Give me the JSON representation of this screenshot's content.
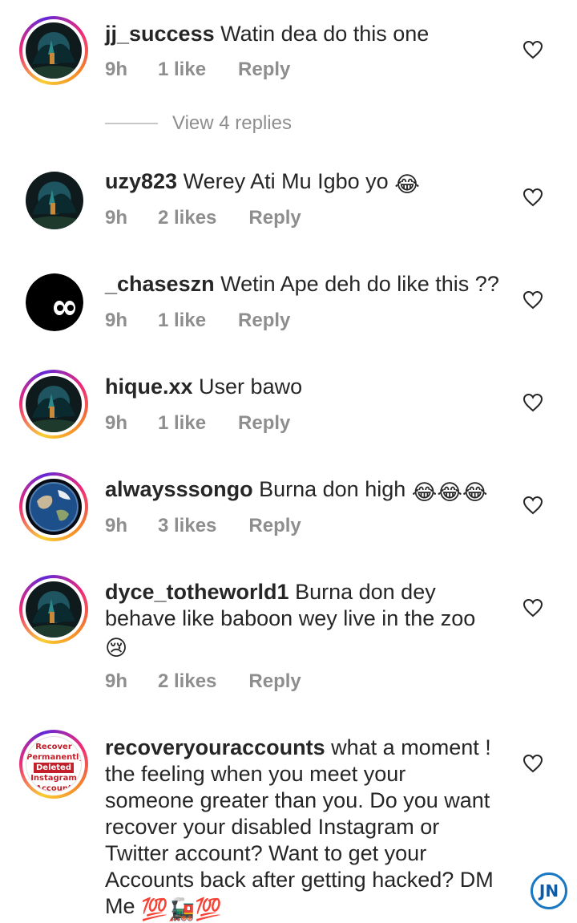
{
  "colors": {
    "text": "#262626",
    "meta": "#8e8e8e",
    "story_ring_start": "#f9ce34",
    "story_ring_mid": "#ee2a7b",
    "story_ring_end": "#6228d7"
  },
  "comments": [
    {
      "username": "jj_success",
      "text": "Watin dea do this one",
      "time": "9h",
      "likes": "1 like",
      "reply": "Reply",
      "avatar": "forest-avatar",
      "has_story": true,
      "view_replies": "View 4 replies"
    },
    {
      "username": "uzy823",
      "text": "Werey Ati Mu Igbo yo",
      "emoji": "😂",
      "time": "9h",
      "likes": "2 likes",
      "reply": "Reply",
      "avatar": "forest-avatar",
      "has_story": false
    },
    {
      "username": "_chaseszn",
      "text": "Wetin Ape deh do like this ??",
      "time": "9h",
      "likes": "1 like",
      "reply": "Reply",
      "avatar": "eyes-avatar",
      "has_story": false
    },
    {
      "username": "hique.xx",
      "text": "User bawo",
      "time": "9h",
      "likes": "1 like",
      "reply": "Reply",
      "avatar": "forest-avatar",
      "has_story": true
    },
    {
      "username": "alwaysssongo",
      "text": "Burna don high",
      "emoji": "😂😂😂",
      "time": "9h",
      "likes": "3 likes",
      "reply": "Reply",
      "avatar": "earth-avatar",
      "has_story": true
    },
    {
      "username": "dyce_totheworld1",
      "text": "Burna don dey behave like baboon wey live in the zoo",
      "emoji": "😢",
      "time": "9h",
      "likes": "2 likes",
      "reply": "Reply",
      "avatar": "forest-avatar",
      "has_story": true
    },
    {
      "username": "recoveryouraccounts",
      "text": "what a moment ! the feeling when you meet your someone greater than you. Do you want recover your disabled Instagram or Twitter account? Want to get your Accounts back after getting hacked? DM  Me",
      "emoji": "💯🚂💯",
      "avatar": "recover-avatar",
      "has_story": true,
      "avatar_text": {
        "line1": "Recover",
        "line2": "Permanently",
        "line3": "Deleted",
        "line4": "Instagram",
        "line5": "Account"
      }
    }
  ],
  "watermark": "JN"
}
